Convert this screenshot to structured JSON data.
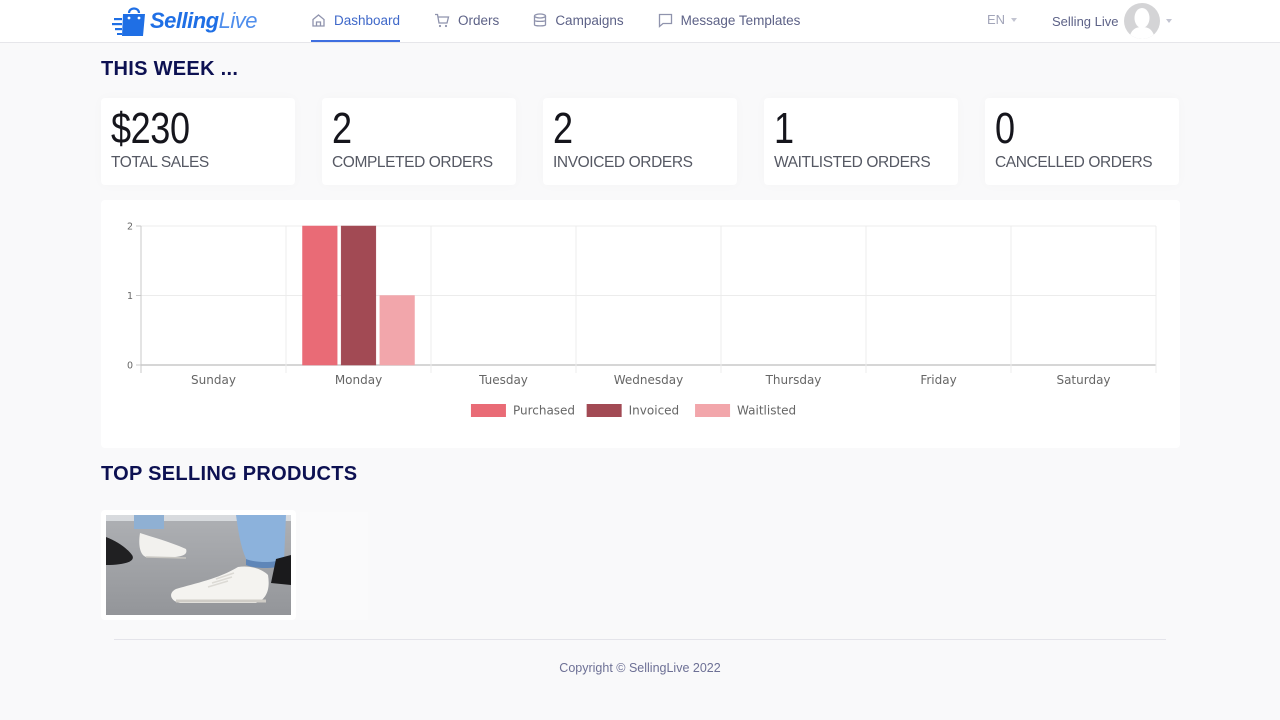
{
  "brand": {
    "name_bold": "Selling",
    "name_light": "Live",
    "color": "#1f6fe5"
  },
  "nav": {
    "items": [
      {
        "label": "Dashboard",
        "icon": "home-icon",
        "active": true
      },
      {
        "label": "Orders",
        "icon": "cart-icon",
        "active": false
      },
      {
        "label": "Campaigns",
        "icon": "database-icon",
        "active": false
      },
      {
        "label": "Message Templates",
        "icon": "message-icon",
        "active": false
      }
    ],
    "language": "EN",
    "user_name": "Selling Live"
  },
  "this_week": {
    "title": "THIS WEEK ...",
    "stats": [
      {
        "value": "$230",
        "label": "TOTAL SALES"
      },
      {
        "value": "2",
        "label": "COMPLETED ORDERS"
      },
      {
        "value": "2",
        "label": "INVOICED ORDERS"
      },
      {
        "value": "1",
        "label": "WAITLISTED ORDERS"
      },
      {
        "value": "0",
        "label": "CANCELLED ORDERS"
      }
    ]
  },
  "chart_data": {
    "type": "bar",
    "title": "",
    "xlabel": "",
    "ylabel": "",
    "categories": [
      "Sunday",
      "Monday",
      "Tuesday",
      "Wednesday",
      "Thursday",
      "Friday",
      "Saturday"
    ],
    "series": [
      {
        "name": "Purchased",
        "color": "#e96b76",
        "values": [
          0,
          2,
          0,
          0,
          0,
          0,
          0
        ]
      },
      {
        "name": "Invoiced",
        "color": "#a24a54",
        "values": [
          0,
          2,
          0,
          0,
          0,
          0,
          0
        ]
      },
      {
        "name": "Waitlisted",
        "color": "#f2a6ab",
        "values": [
          0,
          1,
          0,
          0,
          0,
          0,
          0
        ]
      }
    ],
    "ylim": [
      0,
      2
    ],
    "yticks": [
      "0",
      "1",
      "2"
    ],
    "grid": true,
    "legend": "bottom-center"
  },
  "top_products": {
    "title": "TOP SELLING PRODUCTS",
    "items": [
      {
        "image": "white-sneakers-photo"
      }
    ]
  },
  "footer": {
    "copyright": "Copyright © SellingLive 2022"
  }
}
